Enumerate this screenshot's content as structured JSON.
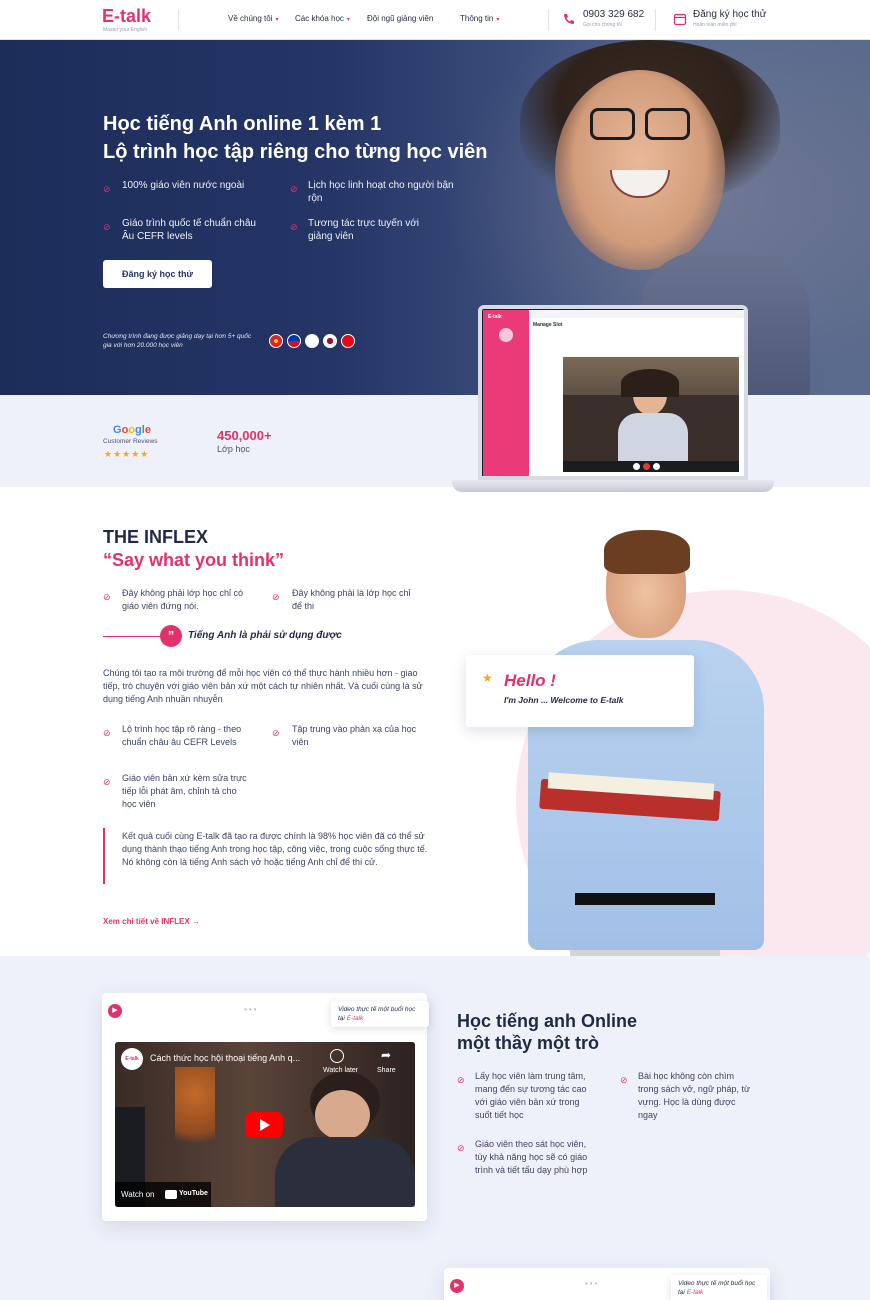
{
  "header": {
    "logo": "E-talk",
    "tagline": "Master your English",
    "nav": [
      {
        "label": "Về chúng tôi",
        "caret": true
      },
      {
        "label": "Các khóa học",
        "caret": true
      },
      {
        "label": "Đội ngũ giảng viên",
        "caret": false
      },
      {
        "label": "Thông tin",
        "caret": true
      }
    ],
    "phone": "0903 329 682",
    "phone_sub": "Gọi cho chúng tôi",
    "trial": "Đăng ký học thử",
    "trial_sub": "Hoàn toàn miễn phí"
  },
  "hero": {
    "title_line1": "Học tiếng Anh online 1 kèm 1",
    "title_line2": "Lộ trình học tập riêng cho từng học viên",
    "features": [
      "100% giáo viên nước ngoài",
      "Lịch học linh hoạt cho người bận rộn",
      "Giáo trình quốc tế chuẩn châu Âu CEFR levels",
      "Tương tác trực tuyến với giảng viên"
    ],
    "cta": "Đăng ký học thử",
    "note": "Chương trình đang được giảng dạy tại hơn 5+ quốc gia với hơn 20.000 học viên"
  },
  "stats": {
    "google": "Google",
    "reviews": "Customer Reviews",
    "count": "450,000+",
    "count_label": "Lớp học"
  },
  "laptop": {
    "app_logo": "E-talk",
    "page_title": "Manage Slot"
  },
  "inflex": {
    "title": "THE INFLEX",
    "subtitle": "“Say what you think”",
    "points_top": [
      "Đây không phải lớp học chỉ có giáo viên đứng nói.",
      "Đây không phải là lớp học chỉ để thi"
    ],
    "quote": "Tiếng Anh là phải sử dụng được",
    "paragraph": "Chúng tôi tạo ra môi trường để mỗi học viên có thể thực hành nhiều hơn - giao tiếp, trò chuyện với giáo viên bản xứ một cách tự nhiên nhất. Và cuối cùng là sử dụng tiếng Anh nhuần nhuyễn",
    "points_bottom": [
      "Lộ trình học tập rõ ràng - theo chuẩn châu âu CEFR Levels",
      "Tập trung vào phản xạ của học viên",
      "Giáo viên bản xứ kèm sửa trực tiếp lỗi phát âm, chỉnh tả cho học viên"
    ],
    "result": "Kết quả cuối cùng E-talk đã tạo ra được chính là 98% học viên đã có thể sử dụng thành thạo tiếng Anh trong học tập, công việc, trong cuộc sống thực tế. Nó không còn là tiếng Anh sách vở hoặc tiếng Anh chỉ để thi cử.",
    "link": "Xem chi tiết về INFLEX  →",
    "hello": "Hello !",
    "hello_sub": "I'm John ... Welcome to E-talk"
  },
  "video_section": {
    "label_prefix": "Video thực tế một buổi học tại",
    "label_brand": "E-talk",
    "video_title": "Cách thức học hội thoại tiếng Anh q...",
    "watch_later": "Watch later",
    "share": "Share",
    "watch_on": "Watch on",
    "youtube": "YouTube",
    "title_line1": "Học tiếng anh Online",
    "title_line2": "một thầy một trò",
    "points": [
      "Lấy học viên làm trung tâm, mang đến sự tương tác cao với giáo viên bản xứ trong suốt tiết học",
      "Bài học không còn chìm trong sách vở, ngữ pháp, từ vựng. Học là dùng được ngay",
      "Giáo viên theo sát học viên, tùy khả năng học sẽ có giáo trình và tiết tấu dạy phù hợp"
    ]
  },
  "colors": {
    "accent": "#e0336b",
    "navy": "#1f2a44",
    "hero_bg": "#243566"
  }
}
